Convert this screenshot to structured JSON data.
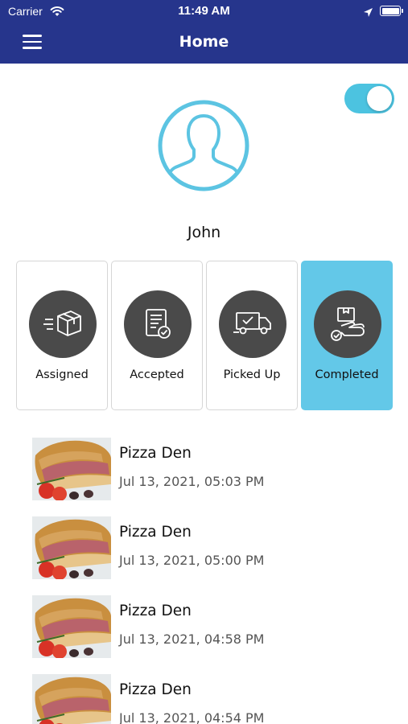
{
  "status_bar": {
    "carrier": "Carrier",
    "time": "11:49 AM"
  },
  "nav": {
    "title": "Home",
    "menu_icon": "hamburger-menu-icon",
    "bar_color": "#26358c"
  },
  "toggle": {
    "state": "on",
    "color": "#4cc3e0"
  },
  "profile": {
    "name": "John",
    "avatar_icon": "user-silhouette-icon"
  },
  "status_cards": [
    {
      "label": "Assigned",
      "icon": "package-delivery-icon",
      "active": false
    },
    {
      "label": "Accepted",
      "icon": "checklist-icon",
      "active": false
    },
    {
      "label": "Picked Up",
      "icon": "delivery-truck-icon",
      "active": false
    },
    {
      "label": "Completed",
      "icon": "hand-over-package-icon",
      "active": true
    }
  ],
  "accent_color": "#63c8e8",
  "orders": [
    {
      "restaurant": "Pizza Den",
      "datetime": "Jul 13, 2021, 05:03 PM"
    },
    {
      "restaurant": "Pizza Den",
      "datetime": "Jul 13, 2021, 05:00 PM"
    },
    {
      "restaurant": "Pizza Den",
      "datetime": "Jul 13, 2021, 04:58 PM"
    },
    {
      "restaurant": "Pizza Den",
      "datetime": "Jul 13, 2021, 04:54 PM"
    }
  ]
}
